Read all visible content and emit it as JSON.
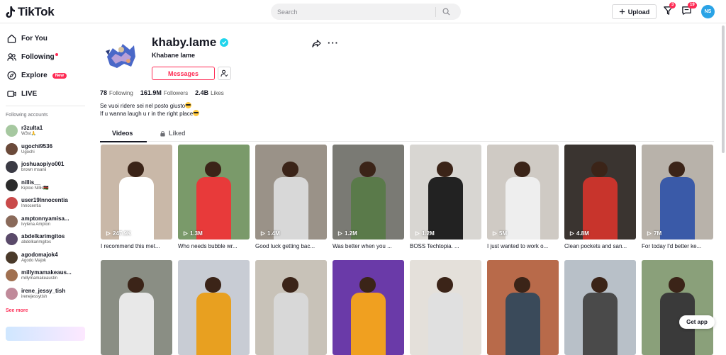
{
  "header": {
    "logo_text": "TikTok",
    "search_placeholder": "Search",
    "upload_label": "Upload",
    "inbox_badge": "3",
    "messages_badge": "19",
    "avatar_initials": "NS"
  },
  "sidebar": {
    "nav": [
      {
        "label": "For You",
        "icon": "home-icon"
      },
      {
        "label": "Following",
        "icon": "following-icon"
      },
      {
        "label": "Explore",
        "icon": "compass-icon",
        "badge": "New"
      },
      {
        "label": "LIVE",
        "icon": "live-icon"
      }
    ],
    "following_title": "Following accounts",
    "accounts": [
      {
        "username": "r3zulta1",
        "name": "W3st🙏",
        "color": "#a6c8a0"
      },
      {
        "username": "ugochi9536",
        "name": "Ugochi",
        "color": "#6b4a3a"
      },
      {
        "username": "joshuaopiyo001",
        "name": "brown msanii",
        "color": "#3a3a44"
      },
      {
        "username": "nillis__",
        "name": "Kiptoo Nillis🇰🇪",
        "color": "#2b2b2b"
      },
      {
        "username": "user19lnnocentia",
        "name": "Innocentia",
        "color": "#c94a4a"
      },
      {
        "username": "amptonnyamisa...",
        "name": "Ivylena Ampton",
        "color": "#8a6a5a"
      },
      {
        "username": "abdelkarimgitos",
        "name": "abdelkarimgitos",
        "color": "#5a4a6a"
      },
      {
        "username": "agodomajok4",
        "name": "Agodo Majok",
        "color": "#4a3a2a"
      },
      {
        "username": "millymamakeaus...",
        "name": "millymamakeaustin",
        "color": "#a07050"
      },
      {
        "username": "irene_jessy_tish",
        "name": "irenejessytish",
        "color": "#c08a9a"
      }
    ],
    "see_more": "See more"
  },
  "profile": {
    "username": "khaby.lame",
    "nickname": "Khabane lame",
    "message_label": "Messages",
    "following_count": "78",
    "following_label": "Following",
    "followers_count": "161.9M",
    "followers_label": "Followers",
    "likes_count": "2.4B",
    "likes_label": "Likes",
    "bio_line1": "Se vuoi ridere sei nel posto giusto",
    "bio_line2": "If u wanna laugh u r in the right place"
  },
  "tabs": {
    "videos": "Videos",
    "liked": "Liked"
  },
  "videos": [
    {
      "views": "247.9K",
      "caption": "I recommend this met...",
      "bg": "#c9b8a8",
      "shirt": "#ffffff"
    },
    {
      "views": "1.3M",
      "caption": "Who needs bubble wr...",
      "bg": "#7a9a6a",
      "shirt": "#e83a3a"
    },
    {
      "views": "1.4M",
      "caption": "Good luck getting bac...",
      "bg": "#9a9288",
      "shirt": "#d8d8d8"
    },
    {
      "views": "1.2M",
      "caption": "Was better when you ...",
      "bg": "#7a7a74",
      "shirt": "#5a7a4a"
    },
    {
      "views": "1.2M",
      "caption": "BOSS Techtopia. ...",
      "bg": "#d8d6d2",
      "shirt": "#222222"
    },
    {
      "views": "5M",
      "caption": "I just wanted to work o...",
      "bg": "#cfcac4",
      "shirt": "#eeeeee"
    },
    {
      "views": "4.8M",
      "caption": "Clean pockets and san...",
      "bg": "#3a3430",
      "shirt": "#c8342c"
    },
    {
      "views": "7M",
      "caption": "For today I'd better ke...",
      "bg": "#b8b2aa",
      "shirt": "#3a5aa8"
    },
    {
      "views": "",
      "caption": "",
      "bg": "#8a8e84",
      "shirt": "#e8e8e8"
    },
    {
      "views": "",
      "caption": "",
      "bg": "#c8ccd4",
      "shirt": "#e8a020"
    },
    {
      "views": "",
      "caption": "",
      "bg": "#c8c2b8",
      "shirt": "#d8d8d8"
    },
    {
      "views": "",
      "caption": "",
      "bg": "#6a3aa8",
      "shirt": "#f0a020"
    },
    {
      "views": "",
      "caption": "",
      "bg": "#e4e0da",
      "shirt": "#e0e0e0"
    },
    {
      "views": "",
      "caption": "",
      "bg": "#b86a4a",
      "shirt": "#3a4a5a"
    },
    {
      "views": "",
      "caption": "",
      "bg": "#b8c0c8",
      "shirt": "#4a4a4a"
    },
    {
      "views": "",
      "caption": "",
      "bg": "#8aa07a",
      "shirt": "#3a3a3a"
    }
  ],
  "get_app": "Get app",
  "colors": {
    "accent": "#fe2c55",
    "verified": "#20d5ec"
  }
}
